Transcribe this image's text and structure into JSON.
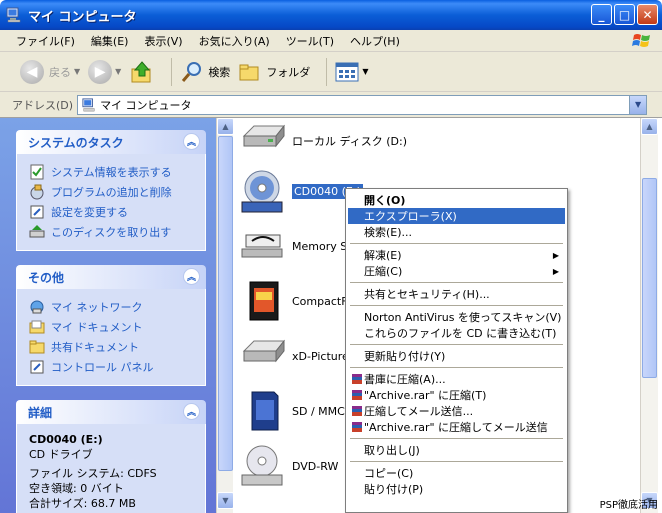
{
  "window": {
    "title": "マイ コンピュータ"
  },
  "menubar": [
    "ファイル(F)",
    "編集(E)",
    "表示(V)",
    "お気に入り(A)",
    "ツール(T)",
    "ヘルプ(H)"
  ],
  "toolbar": {
    "back": "戻る",
    "search": "検索",
    "folders": "フォルダ"
  },
  "address": {
    "label": "アドレス(D)",
    "value": "マイ コンピュータ"
  },
  "system_tasks": {
    "title": "システムのタスク",
    "items": [
      "システム情報を表示する",
      "プログラムの追加と削除",
      "設定を変更する",
      "このディスクを取り出す"
    ]
  },
  "other": {
    "title": "その他",
    "items": [
      "マイ ネットワーク",
      "マイ ドキュメント",
      "共有ドキュメント",
      "コントロール パネル"
    ]
  },
  "details": {
    "title": "詳細",
    "name": "CD0040 (E:)",
    "type": "CD ドライブ",
    "fs": "ファイル システム: CDFS",
    "free": "空き領域: 0 バイト",
    "total": "合計サイズ: 68.7 MB"
  },
  "drives": [
    "ローカル ディスク (D:)",
    "CD0040 (E:)",
    "Memory Stick (F:)",
    "CompactFlash (G:)",
    "xD-Picture Card (H:)",
    "SD / MMC (I:)",
    "DVD-RW"
  ],
  "context_menu": {
    "open": "開く(O)",
    "explore": "エクスプローラ(X)",
    "search": "検索(E)...",
    "extract": "解凍(E)",
    "compress": "圧縮(C)",
    "sharing": "共有とセキュリティ(H)...",
    "norton": "Norton AntiVirus を使ってスキャン(V)",
    "write_cd": "これらのファイルを CD に書き込む(T)",
    "refresh": "更新貼り付け(Y)",
    "rar_add": "書庫に圧縮(A)...",
    "rar_add_named": "\"Archive.rar\" に圧縮(T)",
    "rar_email": "圧縮してメール送信...",
    "rar_email_named": "\"Archive.rar\" に圧縮してメール送信",
    "eject": "取り出し(J)",
    "copy": "コピー(C)",
    "paste": "貼り付け(P)"
  },
  "watermark": "PSP徹底活用"
}
